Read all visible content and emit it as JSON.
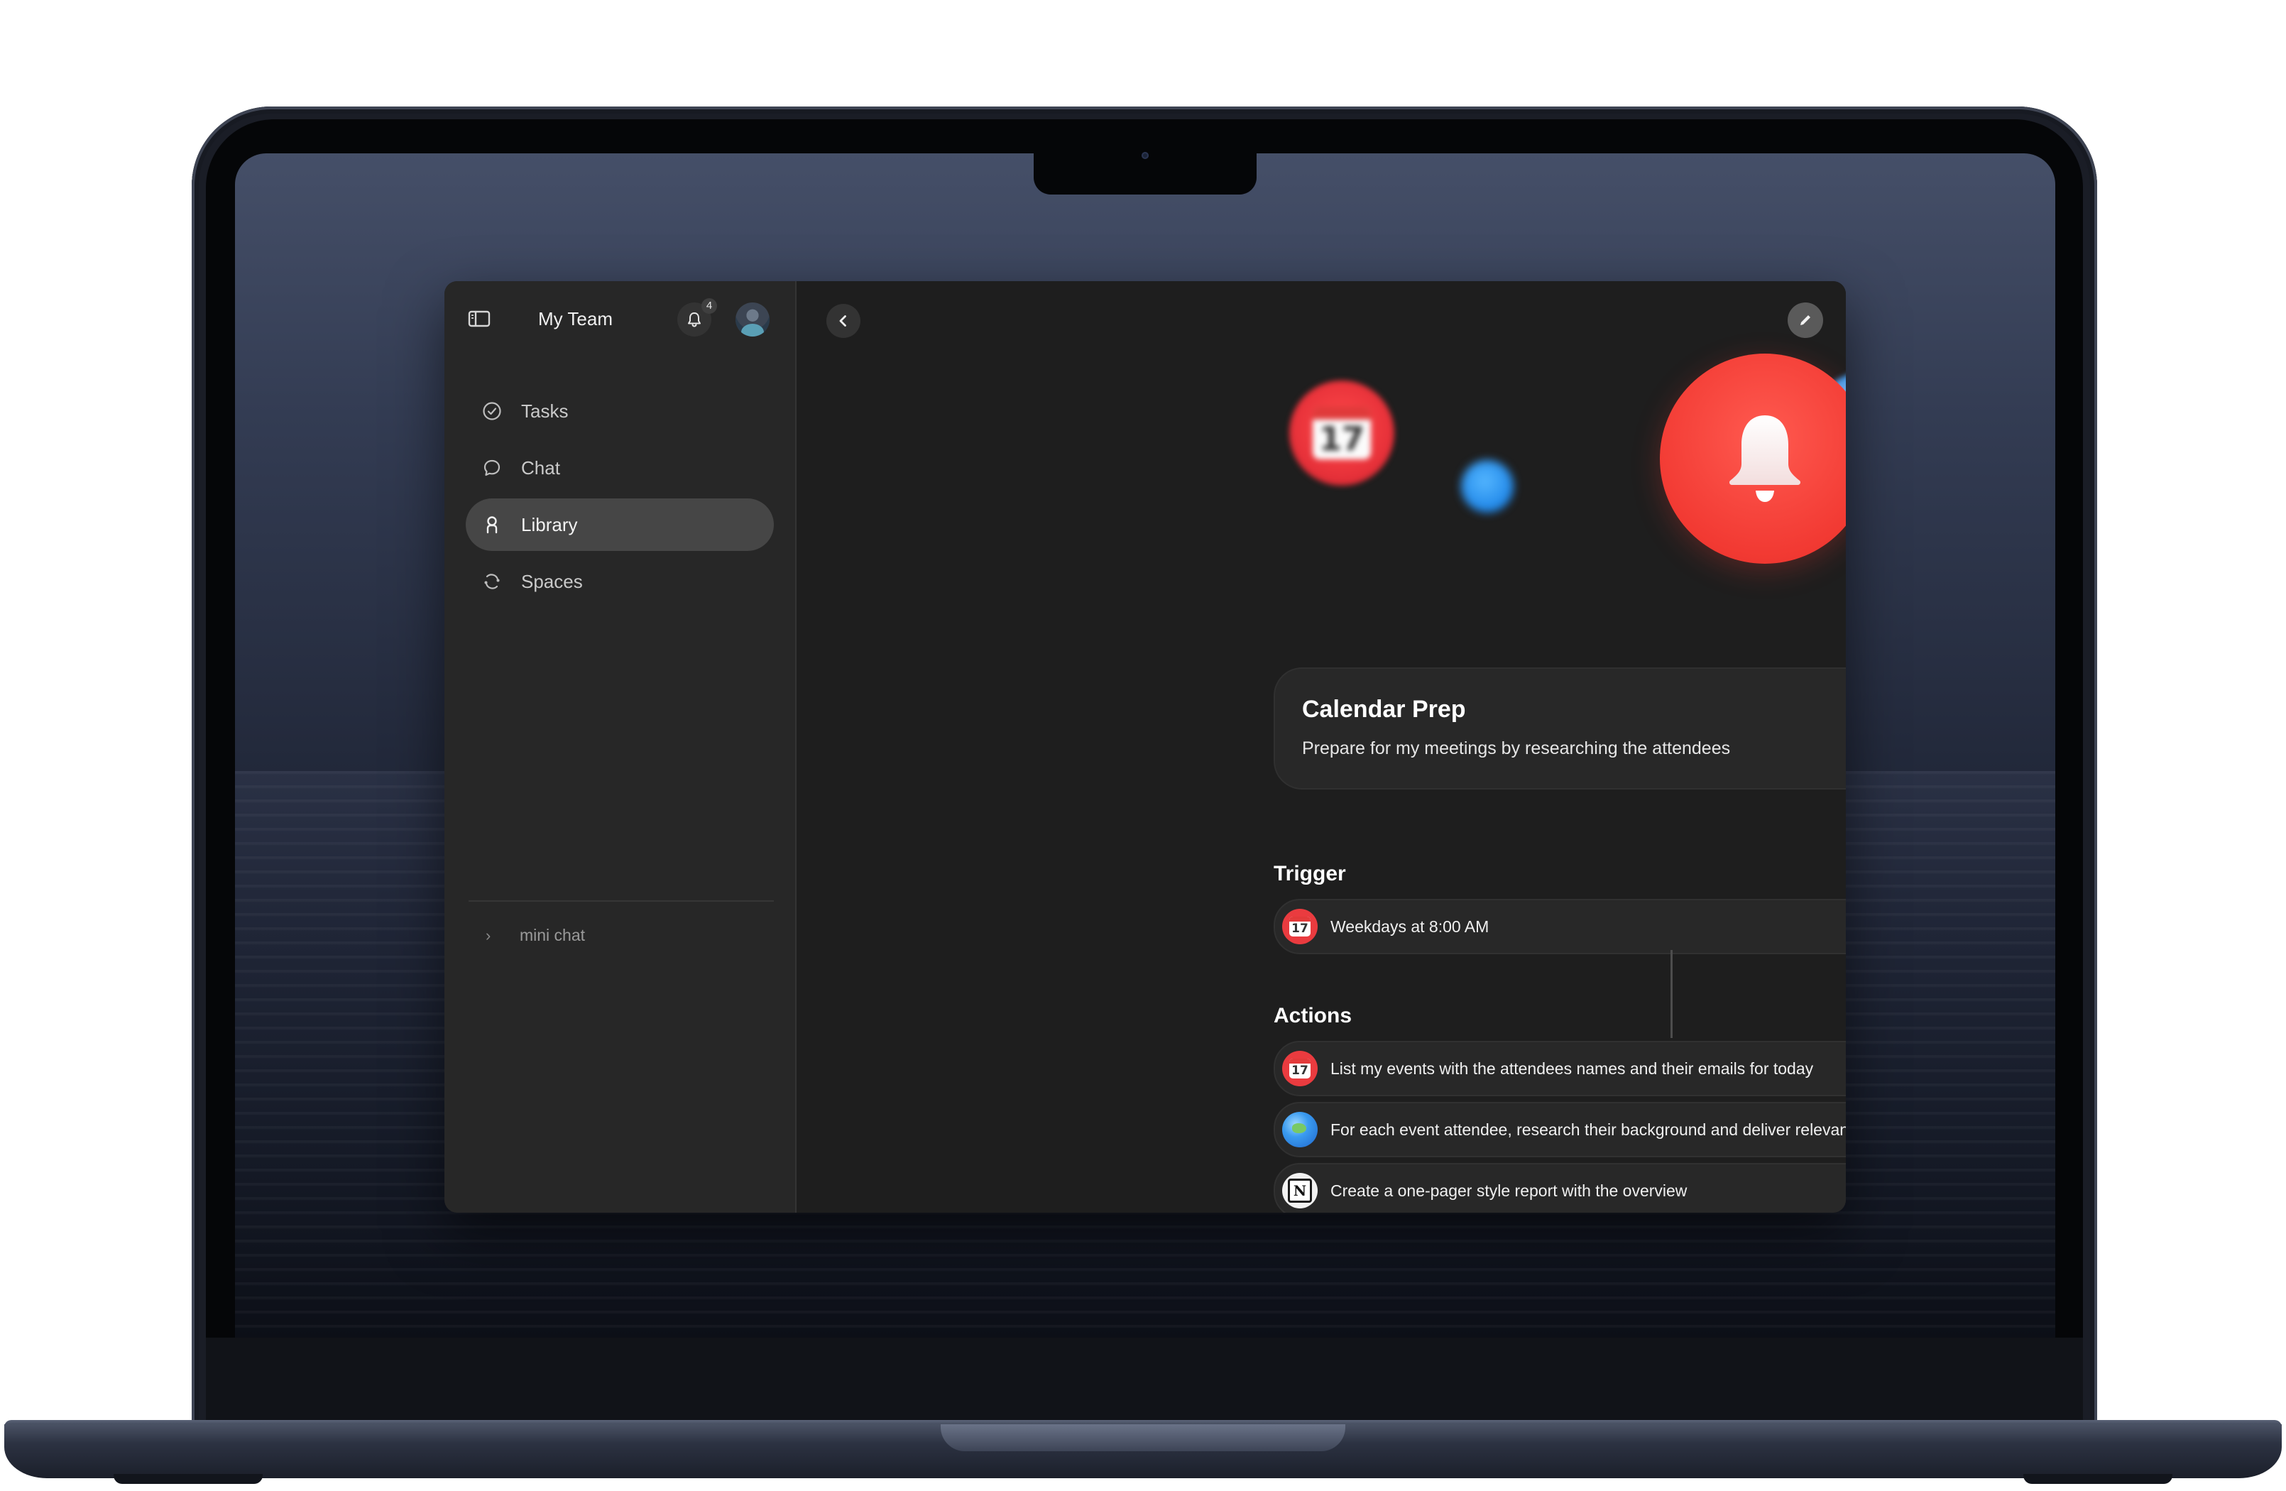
{
  "sidebar": {
    "team_name": "My Team",
    "notification_count": "4",
    "items": [
      {
        "label": "Tasks",
        "icon": "check-circle-icon",
        "active": false
      },
      {
        "label": "Chat",
        "icon": "chat-bubble-icon",
        "active": false
      },
      {
        "label": "Library",
        "icon": "library-icon",
        "active": true
      },
      {
        "label": "Spaces",
        "icon": "spaces-icon",
        "active": false
      }
    ],
    "mini_chat_label": "mini chat"
  },
  "workflow": {
    "title": "Calendar Prep",
    "description": "Prepare for my meetings by researching the attendees",
    "hero_icon": "bell-icon",
    "floating_icons": [
      "calendar-icon",
      "dot-icon",
      "globe-icon",
      "notion-icon"
    ],
    "trigger_heading": "Trigger",
    "trigger": {
      "icon": "calendar-icon",
      "calendar_day": "17",
      "text": "Weekdays at 8:00 AM"
    },
    "actions_heading": "Actions",
    "actions": [
      {
        "icon": "calendar-icon",
        "calendar_day": "17",
        "text": "List my events with the attendees names and their emails for today"
      },
      {
        "icon": "globe-icon",
        "text": "For each event attendee, research their background and deliver relevant info and links"
      },
      {
        "icon": "notion-icon",
        "glyph": "N",
        "text": "Create a one-pager style report with the overview"
      }
    ]
  },
  "colors": {
    "accent_red": "#f23a33",
    "sidebar_bg": "#272727",
    "main_bg": "#1e1e1e",
    "active_item_bg": "#464646"
  }
}
